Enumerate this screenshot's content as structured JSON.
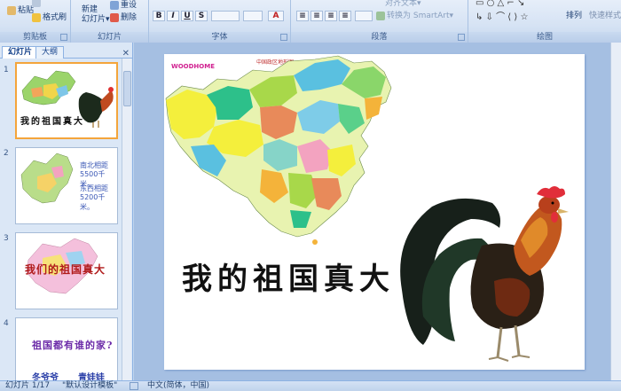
{
  "ribbon": {
    "clipboard": {
      "label": "剪贴板",
      "paste": "粘贴",
      "format_painter": "格式刷"
    },
    "slides": {
      "label": "幻灯片",
      "new_slide_l1": "新建",
      "new_slide_l2": "幻灯片▾",
      "reset": "重设",
      "delete": "删除"
    },
    "font": {
      "label": "字体"
    },
    "paragraph": {
      "label": "段落",
      "align_text": "对齐文本▾",
      "convert_smartart": "转换为 SmartArt▾"
    },
    "drawing": {
      "label": "绘图",
      "arrange": "排列",
      "quick_styles": "快速样式"
    }
  },
  "pane": {
    "tabs": [
      "幻灯片",
      "大纲"
    ],
    "close": "✕",
    "slides": [
      {
        "num": "1",
        "title": "我的祖国真大"
      },
      {
        "num": "2",
        "text_a": "南北相距",
        "text_b": "5500千米。",
        "text_c": "东西相距",
        "text_d": "5200千米。"
      },
      {
        "num": "3",
        "title": "我们的祖国真大"
      },
      {
        "num": "4",
        "title": "祖国都有谁的家?",
        "sub_a": "冬爷爷",
        "sub_b": "青娃娃"
      }
    ]
  },
  "slide": {
    "map_caption": "中国政区地形图",
    "watermark": "WOODHOME",
    "title": "我的祖国真大"
  },
  "status": {
    "slide_count": "幻灯片 1/17",
    "theme": "\"默认设计模板\"",
    "language": "中文(简体，中国)"
  },
  "colors": {
    "accent": "#f4a53b",
    "ribbon": "#d6e3f4",
    "canvas": "#a5bfe2"
  },
  "icons": [
    "paste-icon",
    "format-painter-icon",
    "new-slide-icon",
    "reset-icon",
    "delete-icon",
    "bold-icon",
    "italic-icon",
    "underline-icon",
    "align-icon",
    "close-icon",
    "rooster-image",
    "china-map-image"
  ]
}
